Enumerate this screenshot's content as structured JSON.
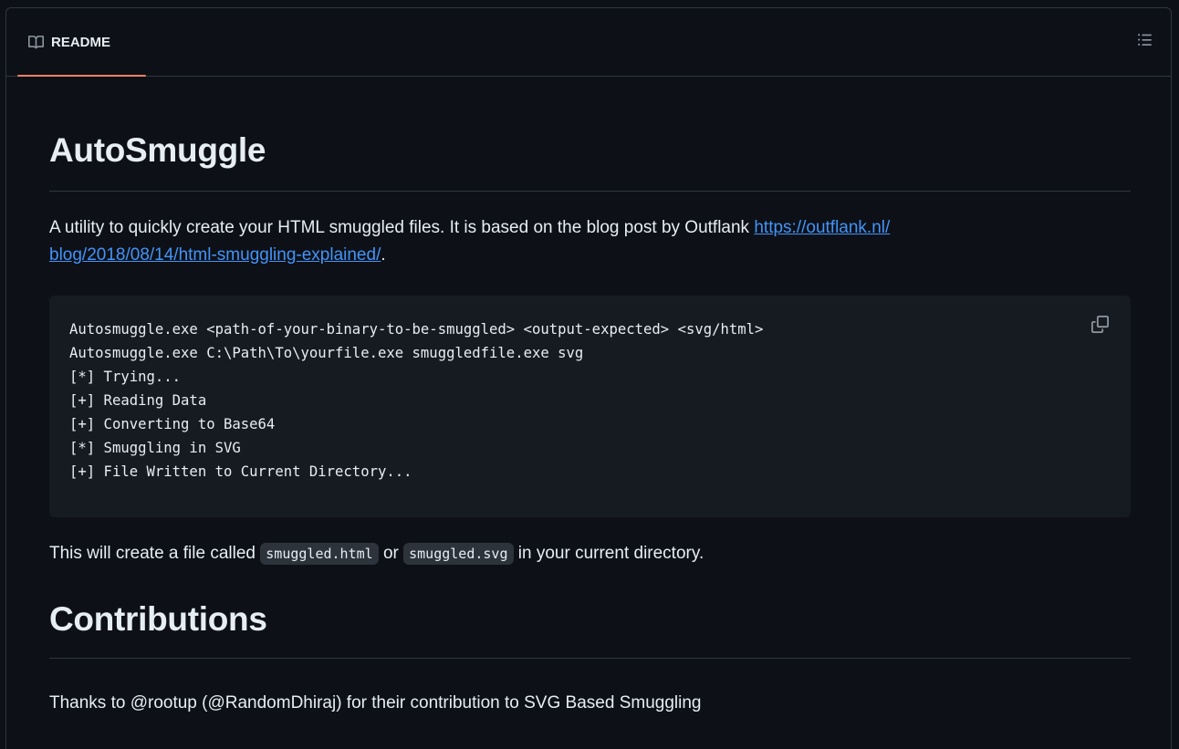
{
  "readme_tab": {
    "label": "README",
    "icon": "book-icon"
  },
  "toolbar": {
    "outline_icon": "list-icon"
  },
  "title": "AutoSmuggle",
  "intro": {
    "text": "A utility to quickly create your HTML smuggled files. It is based on the blog post by Outflank ",
    "link_text_1": "https://outflank.nl/",
    "link_text_2": "blog/2018/08/14/html-smuggling-explained/",
    "suffix": "."
  },
  "code": {
    "lines": [
      "Autosmuggle.exe <path-of-your-binary-to-be-smuggled> <output-expected> <svg/html>",
      "Autosmuggle.exe C:\\Path\\To\\yourfile.exe smuggledfile.exe svg",
      "[*] Trying...",
      "[+] Reading Data",
      "[+] Converting to Base64",
      "[*] Smuggling in SVG",
      "[+] File Written to Current Directory..."
    ],
    "copy_icon": "copy-icon"
  },
  "result": {
    "before": "This will create a file called ",
    "file1": "smuggled.html",
    "middle": " or ",
    "file2": "smuggled.svg",
    "after": " in your current directory."
  },
  "contributions": {
    "heading": "Contributions",
    "text": "Thanks to @rootup (@RandomDhiraj) for their contribution to SVG Based Smuggling"
  },
  "colors": {
    "background": "#0d1117",
    "border": "#30363d",
    "text": "#e6edf3",
    "link": "#4493f8",
    "tab_underline": "#f78166",
    "code_bg": "#161b22"
  }
}
